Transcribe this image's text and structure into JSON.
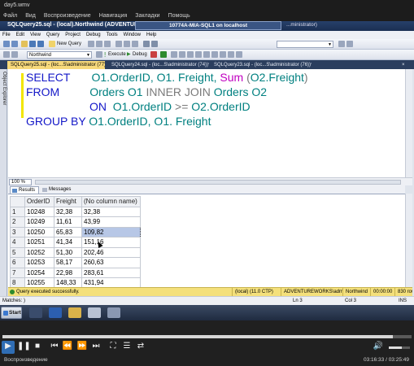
{
  "player": {
    "title": "day5.wmv",
    "menu": [
      "Файл",
      "Вид",
      "Воспроизведение",
      "Навигация",
      "Закладки",
      "Помощь"
    ],
    "status_left": "Воспроизведение",
    "time": "03:16:33 / 03:25:49",
    "progress_fraction": 0.955,
    "volume_fraction": 0.6
  },
  "ssms": {
    "title": "SQLQuery25.sql - (local).Northwind (ADVENTUREWO...",
    "vm_title": "10774A-MIA-SQL1 on localhost",
    "title_right": "...ministrator)",
    "menu": [
      "File",
      "Edit",
      "View",
      "Query",
      "Project",
      "Debug",
      "Tools",
      "Window",
      "Help"
    ],
    "toolbar": {
      "new_query": "New Query",
      "database": "Northwind",
      "execute": "Execute",
      "debug": "Debug"
    },
    "doc_tabs": [
      "SQLQuery25.sql - (loc...S\\administrator (77))*",
      "SQLQuery24.sql - (loc...S\\administrator (74))*",
      "SQLQuery23.sql - (loc...S\\administrator (76))*"
    ],
    "object_explorer": "Object Explorer",
    "editor": {
      "line1": [
        "SELECT",
        "O1.OrderID, O1. Freight, ",
        "Sum",
        " (",
        "O2.Freight",
        ")"
      ],
      "line2": [
        "FROM",
        "Orders O1 ",
        "INNER JOIN",
        " Orders O2"
      ],
      "line3": [
        "ON",
        "  O1.OrderID ",
        ">=",
        " O2.OrderID"
      ],
      "line4": [
        "GROUP BY",
        " O1.OrderID, O1. Freight"
      ]
    },
    "zoom": "100 %",
    "results_tabs": [
      "Results",
      "Messages"
    ],
    "grid": {
      "columns": [
        "OrderID",
        "Freight",
        "(No column name)"
      ],
      "rows": [
        [
          "1",
          "10248",
          "32,38",
          "32,38"
        ],
        [
          "2",
          "10249",
          "11,61",
          "43,99"
        ],
        [
          "3",
          "10250",
          "65,83",
          "109,82"
        ],
        [
          "4",
          "10251",
          "41,34",
          "151,16"
        ],
        [
          "5",
          "10252",
          "51,30",
          "202,46"
        ],
        [
          "6",
          "10253",
          "58,17",
          "260,63"
        ],
        [
          "7",
          "10254",
          "22,98",
          "283,61"
        ],
        [
          "8",
          "10255",
          "148,33",
          "431,94"
        ]
      ]
    },
    "query_status": {
      "message": "Query executed successfully.",
      "server": "(local) (11.0 CTP)",
      "user": "ADVENTUREWORKS\\adminis...",
      "db": "Northwind",
      "elapsed": "00:00:00",
      "rows": "830 rows"
    },
    "status_bar": {
      "left": "Matches: )",
      "ln": "Ln 3",
      "col": "Col 3",
      "mode": "INS"
    },
    "taskbar": {
      "start": "Start"
    }
  },
  "colors": {
    "keyword": "#1418c8",
    "table": "#008080",
    "function": "#c000c0",
    "active_tab": "#f7d97b",
    "status_yellow": "#f4e07b"
  }
}
